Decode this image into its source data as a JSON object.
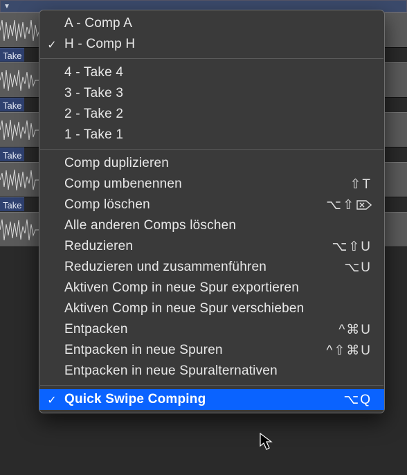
{
  "tracks": {
    "takes": [
      "Take",
      "Take",
      "Take",
      "Take"
    ]
  },
  "menu": {
    "comps": {
      "items": [
        {
          "label": "A - Comp A",
          "checked": false
        },
        {
          "label": "H - Comp H",
          "checked": true
        }
      ]
    },
    "takes": {
      "items": [
        {
          "label": "4 - Take 4"
        },
        {
          "label": "3 - Take 3"
        },
        {
          "label": "2 - Take 2"
        },
        {
          "label": "1 - Take 1"
        }
      ]
    },
    "actions": {
      "duplicate": {
        "label": "Comp duplizieren",
        "shortcut": ""
      },
      "rename": {
        "label": "Comp umbenennen",
        "shortcut": "⇧T"
      },
      "delete": {
        "label": "Comp löschen",
        "shortcut": "⌥⇧",
        "icon": "delete-right"
      },
      "delete_others": {
        "label": "Alle anderen Comps löschen",
        "shortcut": ""
      },
      "flatten": {
        "label": "Reduzieren",
        "shortcut": "⌥⇧U"
      },
      "flatten_merge": {
        "label": "Reduzieren und zusammenführen",
        "shortcut": "⌥U"
      },
      "export_new": {
        "label": "Aktiven Comp in neue Spur exportieren",
        "shortcut": ""
      },
      "move_new": {
        "label": "Aktiven Comp in neue Spur verschieben",
        "shortcut": ""
      },
      "unpack": {
        "label": "Entpacken",
        "shortcut": "^⌘U"
      },
      "unpack_new": {
        "label": "Entpacken in neue Spuren",
        "shortcut": "^⇧⌘U"
      },
      "unpack_alt": {
        "label": "Entpacken in neue Spuralternativen",
        "shortcut": ""
      }
    },
    "quick_swipe": {
      "label": "Quick Swipe Comping",
      "shortcut": "⌥Q",
      "checked": true
    }
  }
}
